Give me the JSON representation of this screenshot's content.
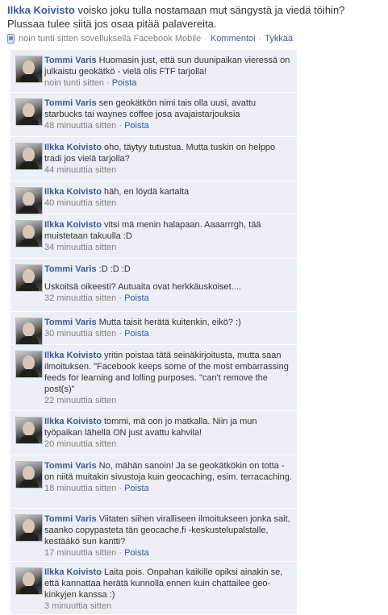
{
  "post": {
    "author": "Ilkka Koivisto",
    "text_1": "voisko joku tulla nostamaan mut sängystä ja viedä töihin?",
    "text_2": "Plussaa tulee siitä jos osaa pitää palavereita.",
    "meta": "noin tunti sitten sovelluksella Facebook Mobile",
    "comment_link": "Kommentoi",
    "like_link": "Tykkää",
    "separator": "·"
  },
  "comments": [
    {
      "author": "Tommi Varis",
      "text": "Huomasin just, että sun duunipaikan vieressä on julkaistu geokätkö - vielä olis FTF tarjolla!",
      "time": "noin tunti sitten",
      "delete": "Poista"
    },
    {
      "author": "Tommi Varis",
      "text": "sen geokätkön nimi tais olla uusi, avattu starbucks tai waynes coffee josa avajaistarjouksia",
      "time": "48 minuuttia sitten",
      "delete": "Poista"
    },
    {
      "author": "Ilkka Koivisto",
      "text": "oho, täytyy tutustua. Mutta tuskin on helppo tradi jos vielä tarjolla?",
      "time": "44 minuuttia sitten",
      "delete": ""
    },
    {
      "author": "Ilkka Koivisto",
      "text": "häh, en löydä kartalta",
      "time": "40 minuuttia sitten",
      "delete": ""
    },
    {
      "author": "Ilkka Koivisto",
      "text": "vitsi mä menin halapaan. Aaaarrrgh, tää muistetaan takuulla :D",
      "time": "34 minuuttia sitten",
      "delete": ""
    },
    {
      "author": "Tommi Varis",
      "text": ":D :D :D",
      "text_2": "Uskoitsä oikeesti? Autuaita ovat herkkäuskoiset....",
      "time": "32 minuuttia sitten",
      "delete": "Poista"
    },
    {
      "author": "Tommi Varis",
      "text": "Mutta taisit herätä kuitenkin, eikö? :)",
      "time": "30 minuuttia sitten",
      "delete": "Poista"
    },
    {
      "author": "Ilkka Koivisto",
      "text": "yritin poistaa tätä seinäkirjoitusta, mutta saan ilmoituksen. \"Facebook keeps some of the most embarrassing feeds for learning and lolling purposes. \"can't remove the post(s)\"",
      "time": "22 minuuttia sitten",
      "delete": ""
    },
    {
      "author": "Ilkka Koivisto",
      "text": "tommi, mä oon jo matkalla. Niin ja mun työpaikan lähellä ON just avattu kahvila!",
      "time": "20 minuuttia sitten",
      "delete": ""
    },
    {
      "author": "Tommi Varis",
      "text": "No, mähän sanoin! Ja se geokätkökin on totta - on niitä muitakin sivustoja kuin geocaching, esim. terracaching.",
      "time": "18 minuuttia sitten",
      "delete": "Poista"
    },
    {
      "author": "Tommi Varis",
      "text": "Viitaten siihen viralliseen ilmoitukseen jonka sait, saanko copypasteta tän geocache.fi -keskustelupalstalle, kestääkö sun kantti?",
      "time": "17 minuuttia sitten",
      "delete": "Poista"
    },
    {
      "author": "Ilkka Koivisto",
      "text": "Laita pois. Onpahan kaikille opiksi ainakin se, että kannattaa herätä kunnolla ennen kuin chattailee geo-kinkyjen kanssa :)",
      "time": "3 minuuttia sitten",
      "delete": ""
    }
  ]
}
